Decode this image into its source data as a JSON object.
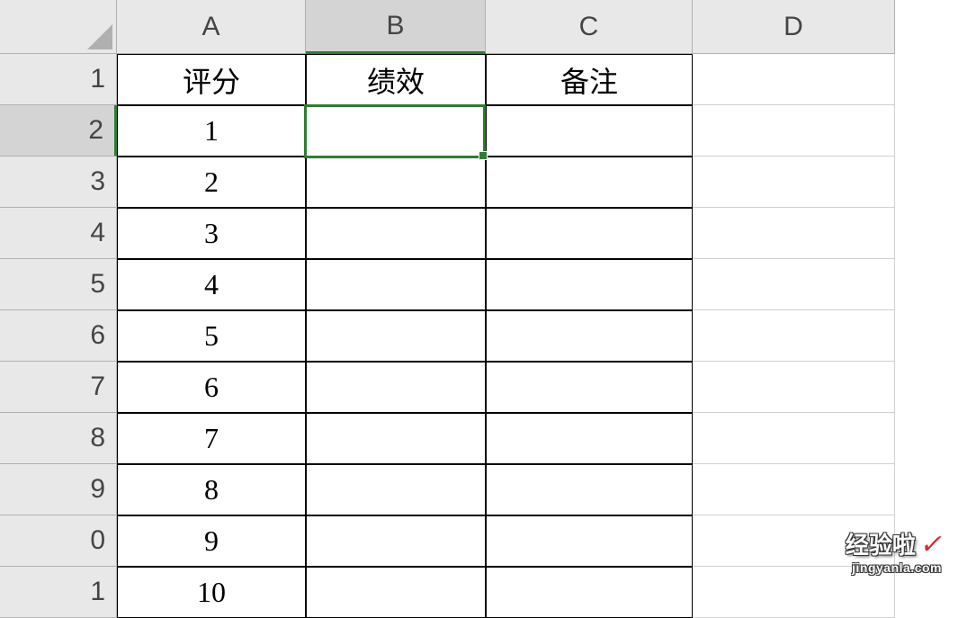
{
  "columns": {
    "a": "A",
    "b": "B",
    "c": "C",
    "d": "D"
  },
  "rowLabels": [
    "1",
    "2",
    "3",
    "4",
    "5",
    "6",
    "7",
    "8",
    "9",
    "0",
    "1"
  ],
  "headers": {
    "colA": "评分",
    "colB": "绩效",
    "colC": "备注"
  },
  "data": {
    "colA": [
      "1",
      "2",
      "3",
      "4",
      "5",
      "6",
      "7",
      "8",
      "9",
      "10"
    ]
  },
  "selectedCell": "B2",
  "watermark": {
    "main": "经验啦",
    "check": "✓",
    "sub": "jingyanla.com"
  }
}
